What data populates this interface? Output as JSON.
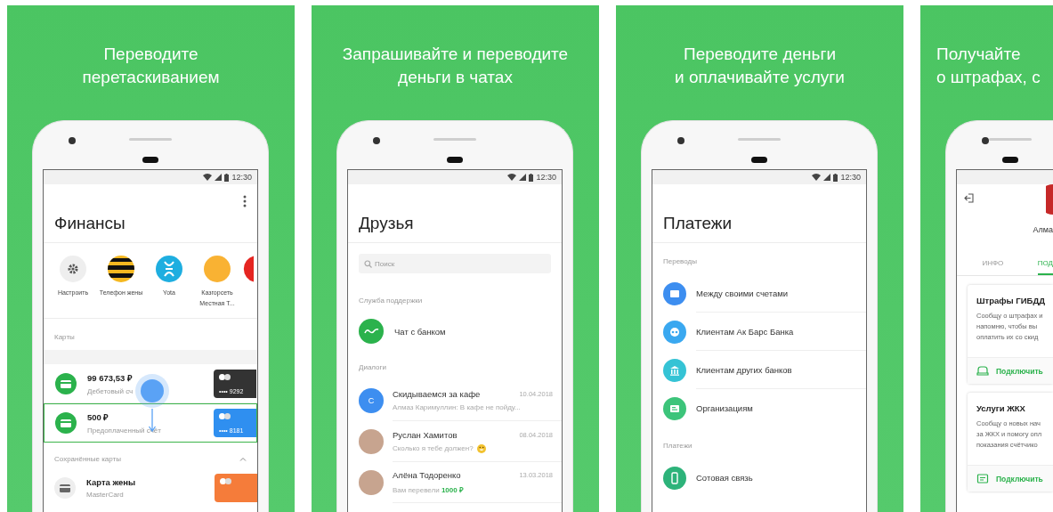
{
  "panels": [
    {
      "caption": [
        "Переводите",
        "перетаскиванием"
      ],
      "screen": {
        "kind": "finances",
        "time": "12:30",
        "title": "Финансы",
        "shortcuts": [
          {
            "kind": "gear",
            "label": "Настроить",
            "color": "#eeeeee"
          },
          {
            "kind": "stripes",
            "label": "Телефон жены",
            "color": "#f5b820"
          },
          {
            "kind": "glyph",
            "label": "Yota",
            "color": "#1eaee0"
          },
          {
            "kind": "plain",
            "label": "Казгорсеть Местная Т...",
            "color": "#f9b233"
          },
          {
            "kind": "partial",
            "color": "#e52521"
          }
        ],
        "cards_section": "Карты",
        "accounts": [
          {
            "amount": "99 673,53 ₽",
            "type": "Дебетовый сч",
            "card_number": "•••• 9292",
            "color": "#333333",
            "highlighted": false
          },
          {
            "amount": "500 ₽",
            "type": "Предоплаченный счёт",
            "card_number": "•••• 8181",
            "color": "#2f8ff0",
            "highlighted": true
          }
        ],
        "saved_section": "Сохранённые карты",
        "saved_expanded": true,
        "saved_cards": [
          {
            "name": "Карта жены",
            "type": "MasterCard",
            "color": "#f57c3a"
          }
        ]
      }
    },
    {
      "caption": [
        "Запрашивайте и переводите",
        "деньги в чатах"
      ],
      "screen": {
        "kind": "friends",
        "time": "12:30",
        "title": "Друзья",
        "search_placeholder": "Поиск",
        "support_section": "Служба поддержки",
        "support_chat": "Чат с банком",
        "dialogs_section": "Диалоги",
        "chats": [
          {
            "kind": "letter",
            "letter": "С",
            "color": "#3d8ef0",
            "name": "Скидываемся за кафе",
            "date": "10.04.2018",
            "preview": "Алмаз Каримуллин: В кафе не пойду...",
            "emoji": false
          },
          {
            "kind": "photo",
            "name": "Руслан Хамитов",
            "date": "08.04.2018",
            "preview": "Сколько я тебе должен?",
            "emoji": true
          },
          {
            "kind": "photo",
            "name": "Алёна Тодоренко",
            "date": "13.03.2018",
            "preview": "Вам перевели **1000 ₽**",
            "emoji": false
          }
        ]
      }
    },
    {
      "caption": [
        "Переводите деньги",
        "и оплачивайте услуги"
      ],
      "screen": {
        "kind": "payments",
        "time": "12:30",
        "title": "Платежи",
        "groups": [
          {
            "label": "Переводы",
            "items": [
              {
                "label": "Между своими счетами",
                "kind": "card",
                "color": "#3d8ef0"
              },
              {
                "label": "Клиентам Ак Барс Банка",
                "kind": "logo",
                "color": "#3aa8f0"
              },
              {
                "label": "Клиентам других банков",
                "kind": "bank",
                "color": "#35c3d5"
              },
              {
                "label": "Организациям",
                "kind": "document",
                "color": "#3cc47a"
              }
            ]
          },
          {
            "label": "Платежи",
            "items": [
              {
                "label": "Сотовая связь",
                "kind": "phone",
                "color": "#2db37a"
              }
            ]
          }
        ]
      }
    },
    {
      "caption": [
        "Получайте",
        "о штрафах, с"
      ],
      "screen": {
        "kind": "services",
        "name": "Алма",
        "tabs": [
          {
            "label": "ИНФО",
            "selected": false
          },
          {
            "label": "ПОД",
            "selected": true
          }
        ],
        "cards": [
          {
            "title": "Штрафы ГИБДД",
            "lines": [
              "Сообщу о штрафах и",
              "напомню, чтобы вы",
              "оплатить их со скид"
            ],
            "action": "Подключить",
            "kind": "car"
          },
          {
            "title": "Услуги ЖКХ",
            "lines": [
              "Сообщу о новых нач",
              "за ЖКХ и помогу опл",
              "показания счётчико"
            ],
            "action": "Подключить",
            "kind": "document"
          }
        ]
      }
    }
  ]
}
